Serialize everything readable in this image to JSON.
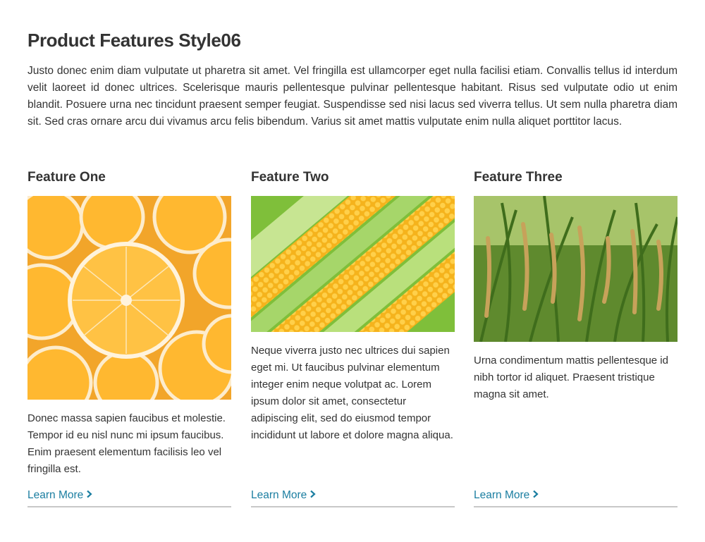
{
  "header": {
    "title": "Product Features Style06",
    "intro": "Justo donec enim diam vulputate ut pharetra sit amet. Vel fringilla est ullamcorper eget nulla facilisi etiam. Convallis tellus id interdum velit laoreet id donec ultrices. Scelerisque mauris pellentesque pulvinar pellentesque habitant. Risus sed vulputate odio ut enim blandit. Posuere urna nec tincidunt praesent semper feugiat. Suspendisse sed nisi lacus sed viverra tellus. Ut sem nulla pharetra diam sit. Sed cras ornare arcu dui vivamus arcu felis bibendum. Varius sit amet mattis vulputate enim nulla aliquet porttitor lacus."
  },
  "features": [
    {
      "title": "Feature One",
      "image": "oranges-photo",
      "text": "Donec massa sapien faucibus et molestie. Tempor id eu nisl nunc mi ipsum faucibus. Enim praesent elementum facilisis leo vel fringilla est.",
      "link": "Learn More"
    },
    {
      "title": "Feature Two",
      "image": "corn-photo",
      "text": "Neque viverra justo nec ultrices dui sapien eget mi. Ut faucibus pulvinar elementum integer enim neque volutpat ac. Lorem ipsum dolor sit amet, consectetur adipiscing elit, sed do eiusmod tempor incididunt ut labore et dolore magna aliqua.",
      "link": "Learn More"
    },
    {
      "title": "Feature Three",
      "image": "rice-photo",
      "text": "Urna condimentum mattis pellentesque id nibh tortor id aliquet. Praesent tristique magna sit amet.",
      "link": "Learn More"
    }
  ],
  "colors": {
    "link": "#1b7ea1",
    "text": "#333333",
    "divider": "#c8c8c8"
  },
  "icons": {
    "link_icon": "chevron-right-icon"
  }
}
